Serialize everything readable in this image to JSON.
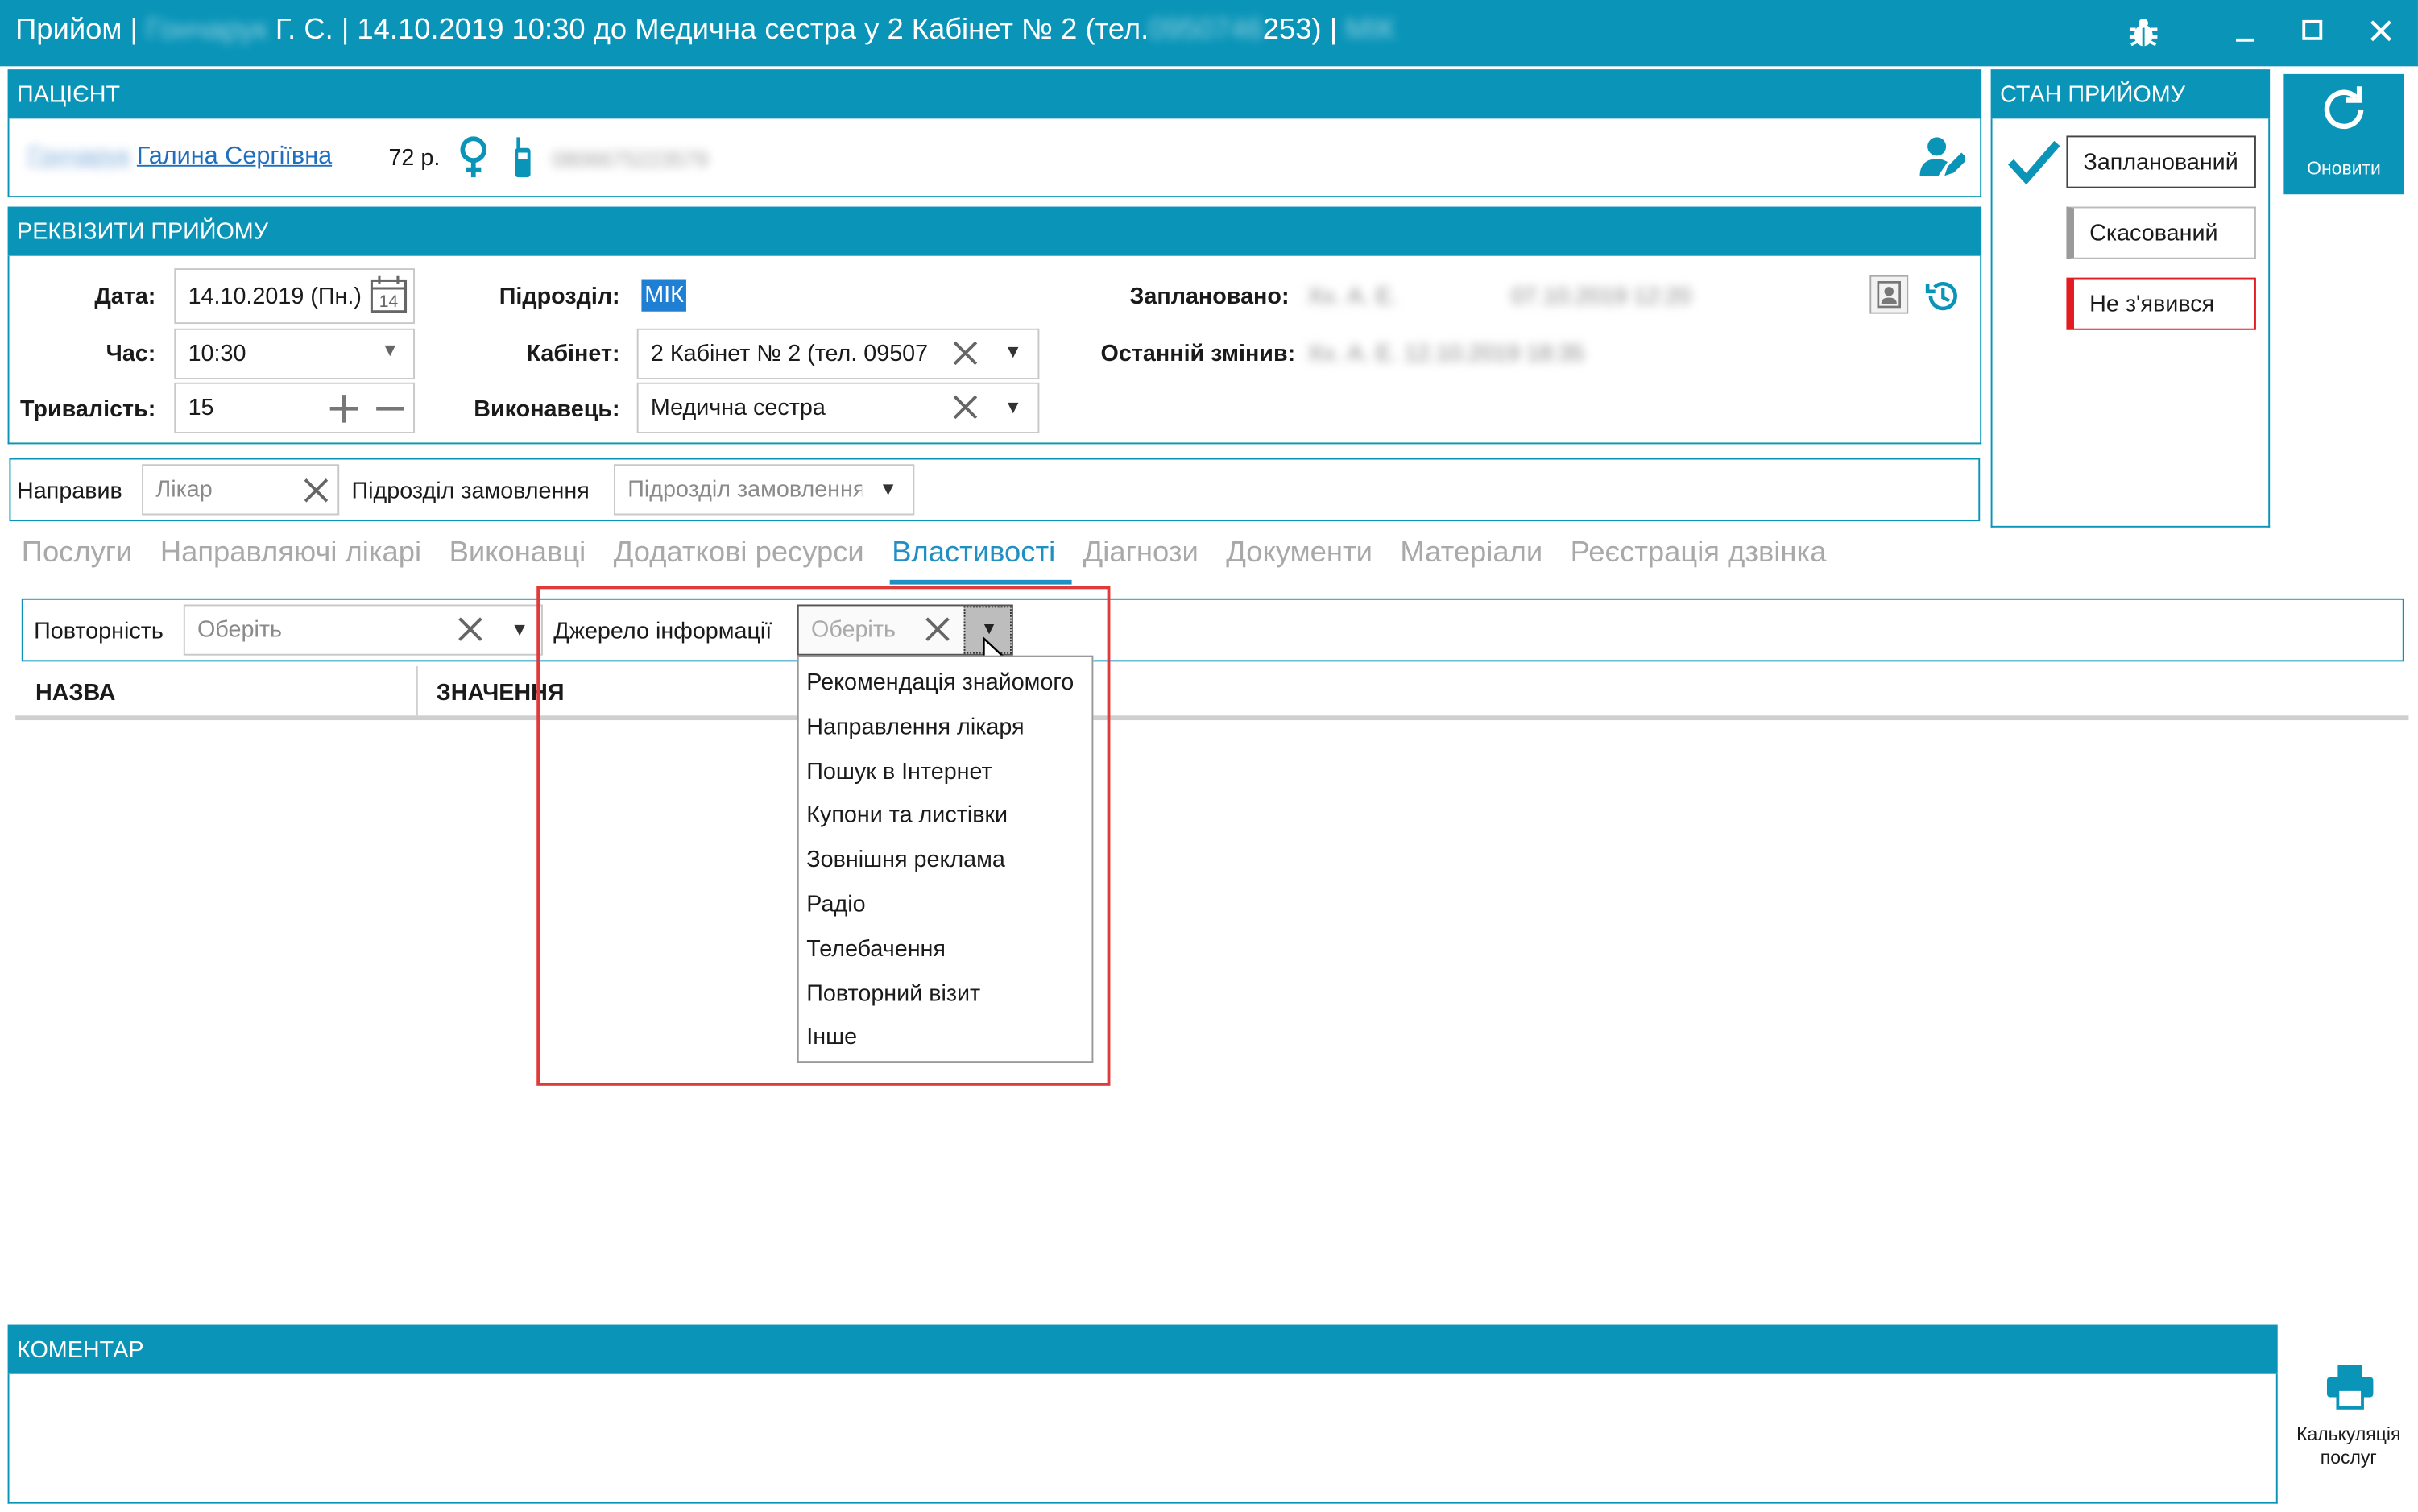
{
  "window": {
    "title_prefix": "Прийом |",
    "title_blur_1": "Гончарук",
    "title_mid": "Г. С. | 14.10.2019 10:30 до Медична сестра у 2 Кабінет № 2 (тел.",
    "title_blur_2": "0950746",
    "title_suffix": "253) |",
    "title_blur_3": "МІК"
  },
  "patient": {
    "header": "ПАЦІЄНТ",
    "surname_blur": "Гончарук",
    "name": "Галина Сергіївна",
    "age": "72 р.",
    "phone_blur": "0806675223579"
  },
  "requisites": {
    "header": "РЕКВІЗИТИ ПРИЙОМУ",
    "date_label": "Дата:",
    "date_value": "14.10.2019 (Пн.)",
    "calendar_day": "14",
    "time_label": "Час:",
    "time_value": "10:30",
    "duration_label": "Тривалість:",
    "duration_value": "15",
    "division_label": "Підрозділ:",
    "division_value": "МІК",
    "cabinet_label": "Кабінет:",
    "cabinet_value": "2 Кабінет № 2 (тел. 09507",
    "performer_label": "Виконавець:",
    "performer_value": "Медична сестра",
    "planned_label": "Заплановано:",
    "planned_blur_name": "Хх. А. Е.",
    "planned_blur_date": "07.10.2019 12:20",
    "changed_label": "Останній змінив:",
    "changed_blur": "Хх. А. Е. 12.10.2019 18:35"
  },
  "referral": {
    "directed_label": "Направив",
    "doctor_placeholder": "Лікар",
    "order_div_label": "Підрозділ замовлення",
    "order_div_placeholder": "Підрозділ замовлення"
  },
  "status": {
    "header": "СТАН ПРИЙОМУ",
    "planned": "Запланований",
    "cancelled": "Скасований",
    "no_show": "Не з'явився",
    "refresh_label": "Оновити"
  },
  "tabs": [
    "Послуги",
    "Направляючі лікарі",
    "Виконавці",
    "Додаткові ресурси",
    "Властивості",
    "Діагнози",
    "Документи",
    "Матеріали",
    "Реєстрація дзвінка"
  ],
  "properties": {
    "repeat_label": "Повторність",
    "repeat_placeholder": "Оберіть",
    "source_label": "Джерело інформації",
    "source_placeholder": "Оберіть",
    "col_name": "НАЗВА",
    "col_value": "ЗНАЧЕННЯ",
    "source_options": [
      "Рекомендація знайомого",
      "Направлення лікаря",
      "Пошук в Інтернет",
      "Купони та листівки",
      "Зовнішня реклама",
      "Радіо",
      "Телебачення",
      "Повторний візит",
      "Інше"
    ]
  },
  "comment": {
    "header": "КОМЕНТАР"
  },
  "print": {
    "label_line1": "Калькуляція",
    "label_line2": "послуг"
  },
  "colors": {
    "accent": "#0994b8",
    "tab_active": "#1f8fc4",
    "no_show_red": "#e31b23",
    "highlight_box": "#e03b3b"
  }
}
